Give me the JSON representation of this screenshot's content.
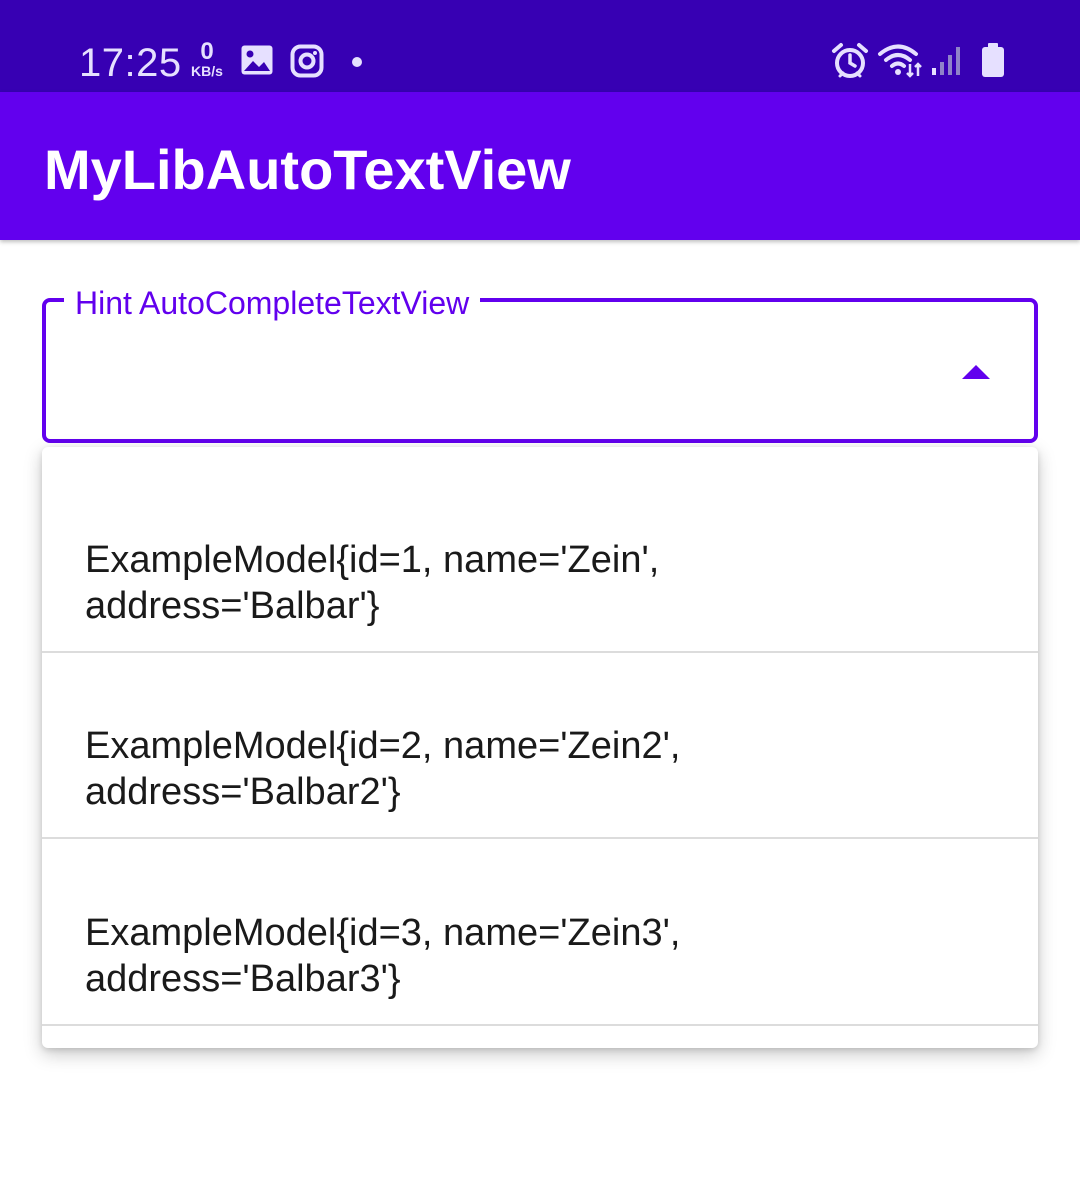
{
  "status_bar": {
    "time": "17:25",
    "net_speed_value": "0",
    "net_speed_unit": "KB/s",
    "left_icons": [
      "gallery-icon",
      "instagram-icon",
      "notification-dot-icon"
    ],
    "right_icons": [
      "alarm-icon",
      "wifi-icon",
      "signal-icon",
      "battery-icon"
    ],
    "background_color": "#3700B3"
  },
  "app_bar": {
    "title": "MyLibAutoTextView",
    "background_color": "#6200EE"
  },
  "autocomplete": {
    "hint": "Hint AutoCompleteTextView",
    "value": "",
    "accent_color": "#6200EE",
    "toggle_icon": "arrow-drop-up-icon",
    "expanded": true
  },
  "dropdown": {
    "items": [
      {
        "line1": "ExampleModel{id=1, name='Zein',",
        "line2": "address='Balbar'}"
      },
      {
        "line1": "ExampleModel{id=2, name='Zein2',",
        "line2": "address='Balbar2'}"
      },
      {
        "line1": "ExampleModel{id=3, name='Zein3',",
        "line2": "address='Balbar3'}"
      }
    ]
  }
}
